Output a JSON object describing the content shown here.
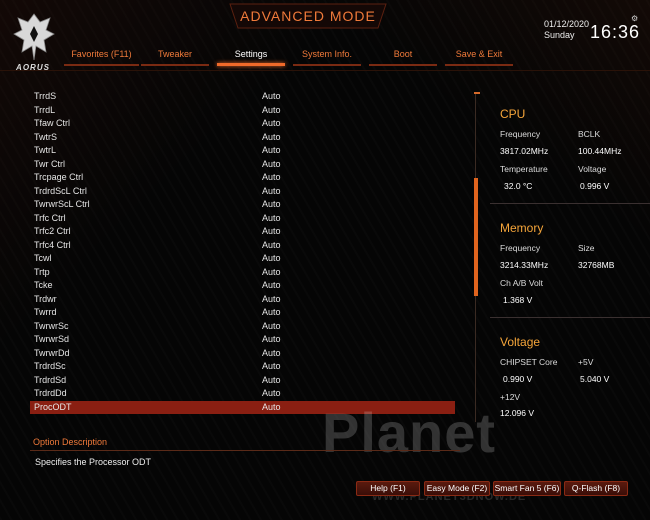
{
  "app": {
    "title": "ADVANCED MODE",
    "brand": "AORUS",
    "date": "01/12/2020",
    "day": "Sunday",
    "time": "16:36",
    "accent_color": "#f07a3a",
    "icons": [
      "aorus-eagle-logo",
      "gear-icon"
    ]
  },
  "tabs": [
    {
      "label": "Favorites (F11)"
    },
    {
      "label": "Tweaker"
    },
    {
      "label": "Settings",
      "active": true
    },
    {
      "label": "System Info."
    },
    {
      "label": "Boot"
    },
    {
      "label": "Save & Exit"
    }
  ],
  "settings": [
    {
      "name": "TrrdS",
      "value": "Auto"
    },
    {
      "name": "TrrdL",
      "value": "Auto"
    },
    {
      "name": "Tfaw Ctrl",
      "value": "Auto"
    },
    {
      "name": "TwtrS",
      "value": "Auto"
    },
    {
      "name": "TwtrL",
      "value": "Auto"
    },
    {
      "name": "Twr Ctrl",
      "value": "Auto"
    },
    {
      "name": "Trcpage Ctrl",
      "value": "Auto"
    },
    {
      "name": "TrdrdScL Ctrl",
      "value": "Auto"
    },
    {
      "name": "TwrwrScL Ctrl",
      "value": "Auto"
    },
    {
      "name": "Trfc Ctrl",
      "value": "Auto"
    },
    {
      "name": "Trfc2 Ctrl",
      "value": "Auto"
    },
    {
      "name": "Trfc4 Ctrl",
      "value": "Auto"
    },
    {
      "name": "Tcwl",
      "value": "Auto"
    },
    {
      "name": "Trtp",
      "value": "Auto"
    },
    {
      "name": "Tcke",
      "value": "Auto"
    },
    {
      "name": "Trdwr",
      "value": "Auto"
    },
    {
      "name": "Twrrd",
      "value": "Auto"
    },
    {
      "name": "TwrwrSc",
      "value": "Auto"
    },
    {
      "name": "TwrwrSd",
      "value": "Auto"
    },
    {
      "name": "TwrwrDd",
      "value": "Auto"
    },
    {
      "name": "TrdrdSc",
      "value": "Auto"
    },
    {
      "name": "TrdrdSd",
      "value": "Auto"
    },
    {
      "name": "TrdrdDd",
      "value": "Auto"
    },
    {
      "name": "ProcODT",
      "value": "Auto",
      "selected": true
    }
  ],
  "cpu": {
    "title": "CPU",
    "frequency_label": "Frequency",
    "frequency_value": "3817.02MHz",
    "bclk_label": "BCLK",
    "bclk_value": "100.44MHz",
    "temperature_label": "Temperature",
    "temperature_value": "32.0 °C",
    "voltage_label": "Voltage",
    "voltage_value": "0.996 V"
  },
  "memory": {
    "title": "Memory",
    "frequency_label": "Frequency",
    "frequency_value": "3214.33MHz",
    "size_label": "Size",
    "size_value": "32768MB",
    "volt_label": "Ch A/B Volt",
    "volt_value": "1.368 V"
  },
  "voltage": {
    "title": "Voltage",
    "chipset_label": "CHIPSET Core",
    "chipset_value": "0.990 V",
    "p5v_label": "+5V",
    "p5v_value": "5.040 V",
    "p12v_label": "+12V",
    "p12v_value": "12.096 V"
  },
  "option": {
    "title": "Option Description",
    "text": "Specifies the Processor ODT"
  },
  "footer": {
    "help": "Help (F1)",
    "easy_mode": "Easy Mode (F2)",
    "smart_fan": "Smart Fan 5 (F6)",
    "qflash": "Q-Flash (F8)"
  },
  "watermark": {
    "main": "Planet",
    "sub": "WWW.PLANET3DNOW.DE"
  },
  "scroll": {
    "position_fraction": 0.26,
    "visible_fraction": 0.36
  }
}
